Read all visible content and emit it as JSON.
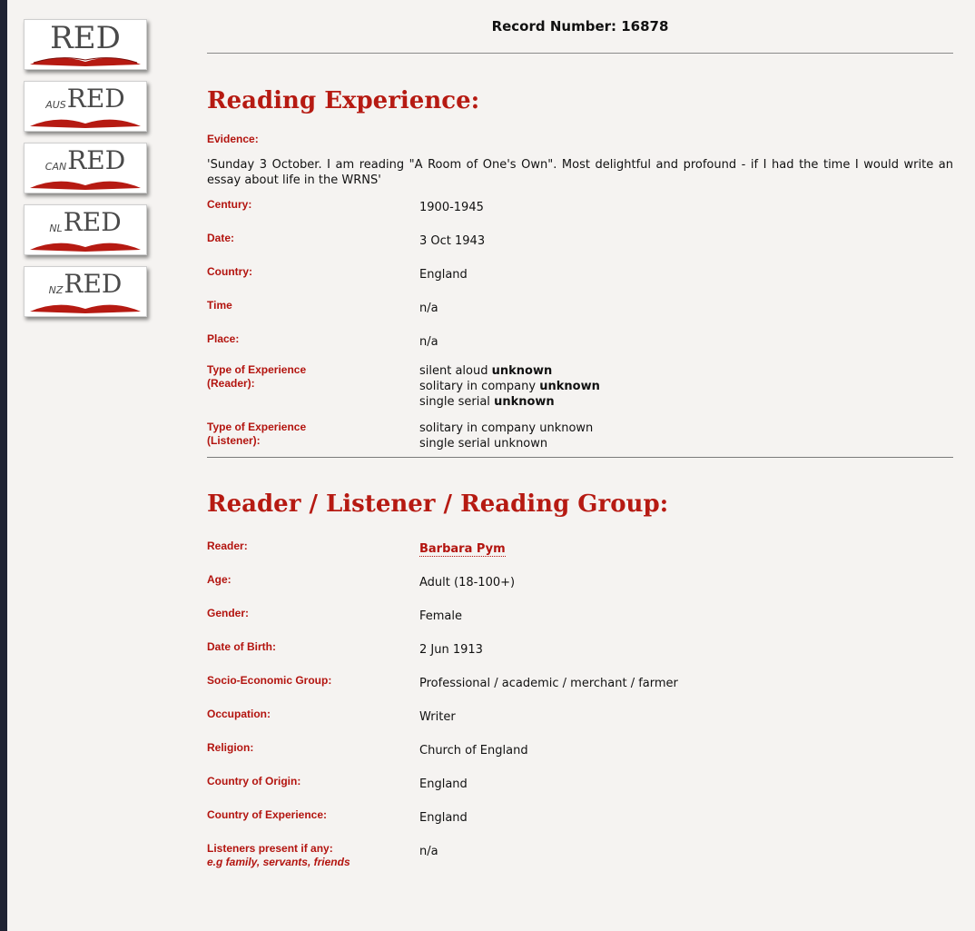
{
  "sidebar": {
    "logos": [
      {
        "prefix": "",
        "text": "RED"
      },
      {
        "prefix": "AUS",
        "text": "RED"
      },
      {
        "prefix": "CAN",
        "text": "RED"
      },
      {
        "prefix": "NL",
        "text": "RED"
      },
      {
        "prefix": "NZ",
        "text": "RED"
      }
    ]
  },
  "record": {
    "label": "Record Number: 16878"
  },
  "reading": {
    "heading": "Reading Experience:",
    "evidence_label": "Evidence:",
    "evidence_text": "'Sunday 3 October. I am reading \"A Room of One's Own\". Most delightful and profound - if I had the time I would write an essay about life in the WRNS'",
    "century_label": "Century:",
    "century": "1900-1945",
    "date_label": "Date:",
    "date": "3 Oct 1943",
    "country_label": "Country:",
    "country": "England",
    "time_label": "Time",
    "time": "n/a",
    "place_label": "Place:",
    "place": "n/a",
    "type_reader_label1": "Type of Experience",
    "type_reader_label2": "(Reader):",
    "type_reader": [
      {
        "text": "silent aloud",
        "bold": "unknown"
      },
      {
        "text": "solitary in company",
        "bold": "unknown"
      },
      {
        "text": "single serial",
        "bold": "unknown"
      }
    ],
    "type_listener_label1": "Type of Experience",
    "type_listener_label2": "(Listener):",
    "type_listener": [
      "solitary in company unknown",
      "single serial unknown"
    ]
  },
  "reader": {
    "heading": "Reader / Listener / Reading Group:",
    "reader_label": "Reader:",
    "reader": "Barbara Pym",
    "age_label": "Age:",
    "age": "Adult (18-100+)",
    "gender_label": "Gender:",
    "gender": "Female",
    "dob_label": "Date of Birth:",
    "dob": "2 Jun 1913",
    "seg_label": "Socio-Economic Group:",
    "seg": "Professional / academic / merchant / farmer",
    "occupation_label": "Occupation:",
    "occupation": "Writer",
    "religion_label": "Religion:",
    "religion": "Church of England",
    "origin_label": "Country of Origin:",
    "origin": "England",
    "experience_label": "Country of Experience:",
    "experience": "England",
    "listeners_label1": "Listeners present if any:",
    "listeners_label2": "e.g family, servants, friends",
    "listeners": "n/a"
  }
}
